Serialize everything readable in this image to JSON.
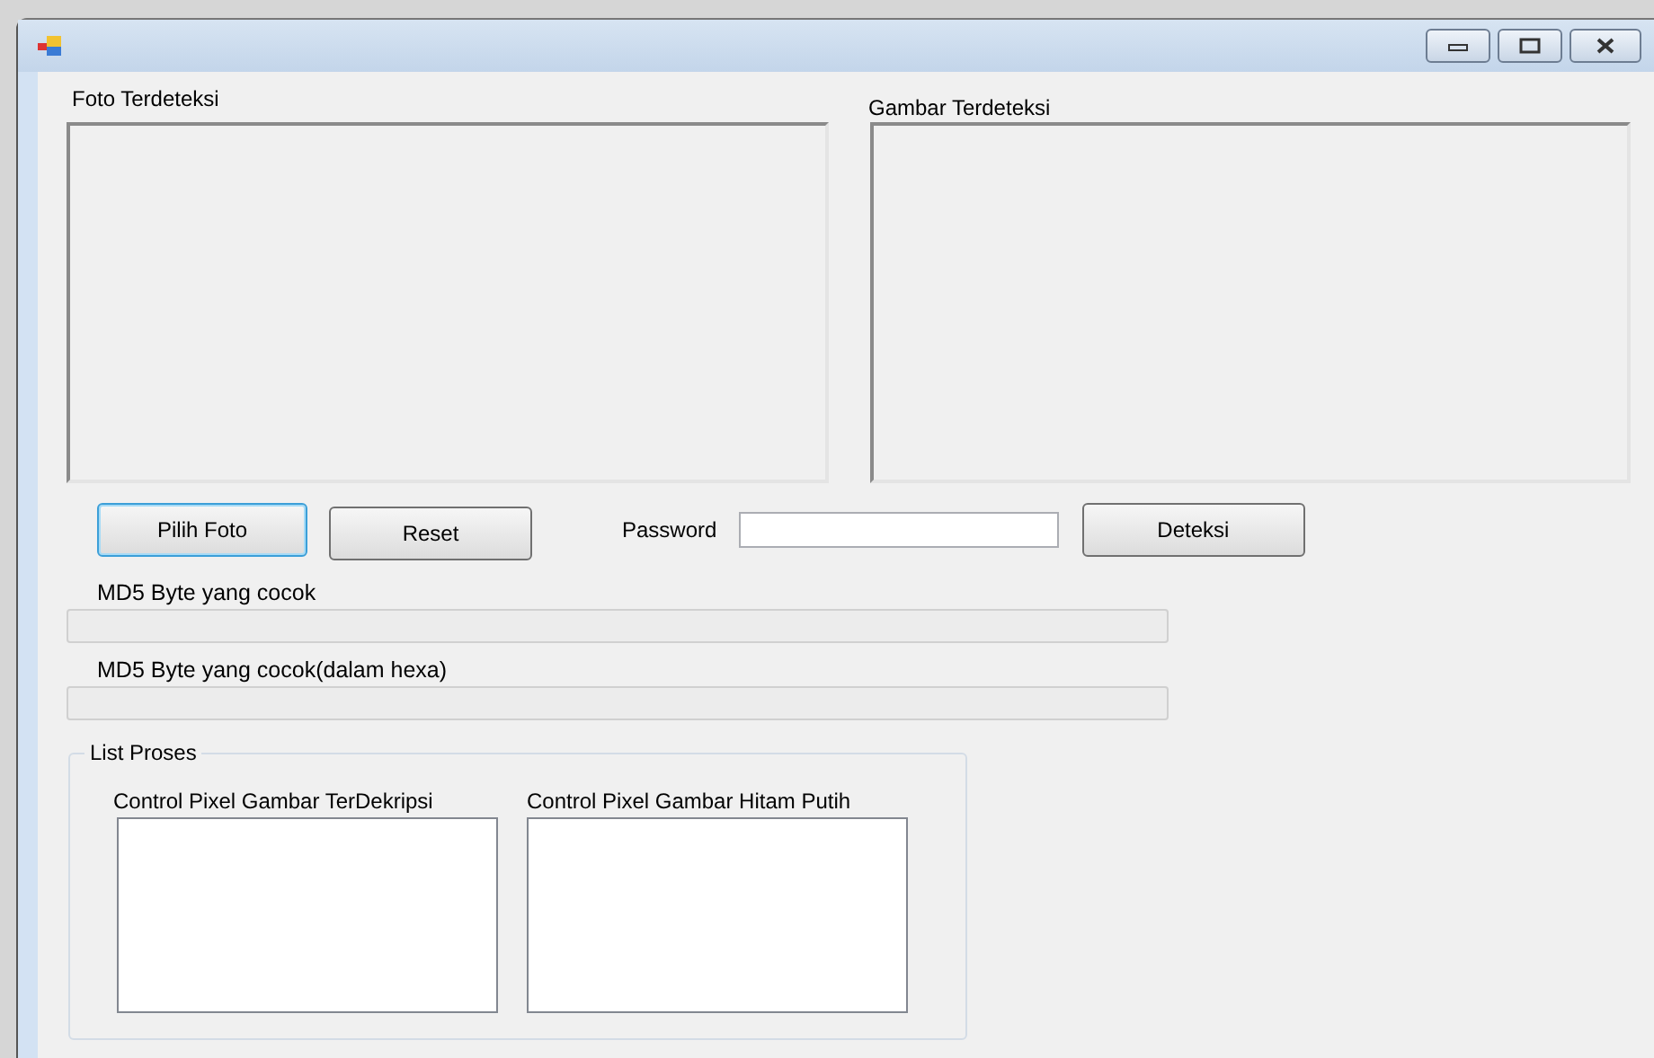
{
  "window": {
    "controls": [
      {
        "kind": "minimize"
      },
      {
        "kind": "maximize"
      },
      {
        "kind": "close"
      }
    ]
  },
  "picture_boxes": [
    {
      "label": "Foto Terdeteksi"
    },
    {
      "label": "Gambar Terdeteksi"
    }
  ],
  "buttons_row": {
    "buttons": [
      {
        "label": "Pilih Foto",
        "focused": true
      },
      {
        "label": "Reset",
        "focused": false
      }
    ],
    "password": {
      "label": "Password"
    },
    "detect_button": {
      "label": "Deteksi",
      "focused": false
    }
  },
  "fields": [
    {
      "label": "MD5 Byte yang cocok"
    },
    {
      "label": "MD5 Byte yang cocok(dalam hexa)"
    }
  ],
  "group": {
    "title": "List Proses",
    "lists": [
      {
        "label": "Control Pixel Gambar TerDekripsi"
      },
      {
        "label": "Control Pixel Gambar Hitam Putih"
      }
    ]
  }
}
